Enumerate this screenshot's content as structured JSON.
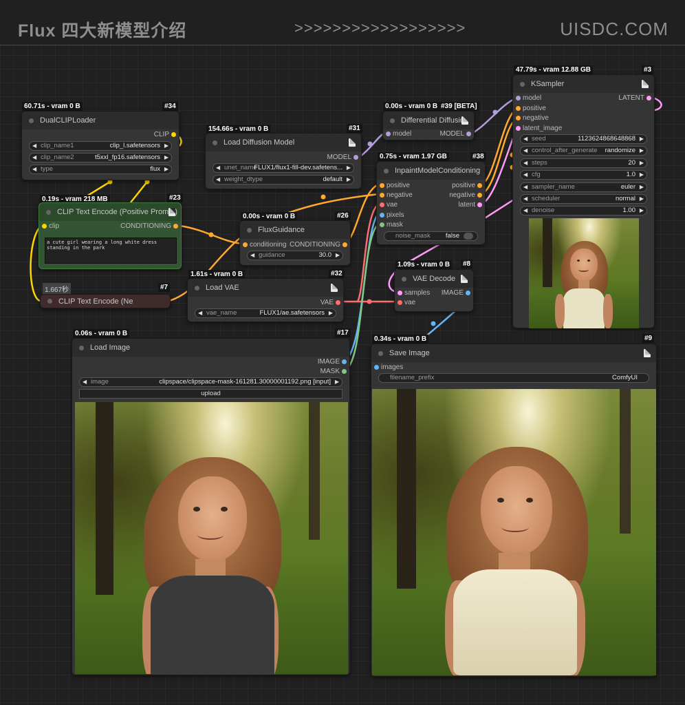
{
  "header": {
    "title": "Flux 四大新模型介绍",
    "arrows": ">>>>>>>>>>>>>>>>>>",
    "brand": "UISDC.COM"
  },
  "colors": {
    "clip": "#ffd500",
    "conditioning": "#ffa931",
    "model": "#b39ddb",
    "vae": "#ff6e6e",
    "latent": "#ff9cf9",
    "image": "#64b5f6",
    "mask": "#81c784"
  },
  "nodes": {
    "dualclip": {
      "time": "60.71s - vram 0 B",
      "id": "#34",
      "title": "DualCLIPLoader",
      "out": "CLIP",
      "widgets": [
        {
          "label": "clip_name1",
          "value": "clip_l.safetensors"
        },
        {
          "label": "clip_name2",
          "value": "t5xxl_fp16.safetensors"
        },
        {
          "label": "type",
          "value": "flux"
        }
      ]
    },
    "clippos": {
      "time": "0.19s - vram 218 MB",
      "id": "#23",
      "title": "CLIP Text Encode (Positive Prompt)",
      "in": "clip",
      "out": "CONDITIONING",
      "text": "a cute girl wearing a long white dress standing in the park"
    },
    "clipneg": {
      "badge": "1.667秒",
      "id": "#7",
      "title": "CLIP Text Encode (Ne"
    },
    "loaddiff": {
      "time": "154.66s - vram 0 B",
      "id": "#31",
      "title": "Load Diffusion Model",
      "out": "MODEL",
      "widgets": [
        {
          "label": "unet_name",
          "value": "FLUX1/flux1-fill-dev.safetens..."
        },
        {
          "label": "weight_dtype",
          "value": "default"
        }
      ]
    },
    "fluxguid": {
      "time": "0.00s - vram 0 B",
      "id": "#26",
      "title": "FluxGuidance",
      "in": "conditioning",
      "out": "CONDITIONING",
      "widgets": [
        {
          "label": "guidance",
          "value": "30.0"
        }
      ]
    },
    "loadvae": {
      "time": "1.61s - vram 0 B",
      "id": "#32",
      "title": "Load VAE",
      "out": "VAE",
      "widgets": [
        {
          "label": "vae_name",
          "value": "FLUX1/ae.safetensors"
        }
      ]
    },
    "diffdiff": {
      "time": "0.00s - vram 0 B",
      "id": "#39 [BETA]",
      "title": "Differential Diffusion",
      "in": "model",
      "out": "MODEL"
    },
    "inpaint": {
      "time": "0.75s - vram 1.97 GB",
      "id": "#38",
      "title": "InpaintModelConditioning",
      "ins": [
        "positive",
        "negative",
        "vae",
        "pixels",
        "mask"
      ],
      "outs": [
        "positive",
        "negative",
        "latent"
      ],
      "toggle": {
        "label": "noise_mask",
        "value": "false"
      }
    },
    "vaedecode": {
      "time": "1.09s - vram 0 B",
      "id": "#8",
      "title": "VAE Decode",
      "ins": [
        "samples",
        "vae"
      ],
      "out": "IMAGE"
    },
    "ksampler": {
      "time": "47.79s - vram 12.88 GB",
      "id": "#3",
      "title": "KSampler",
      "ins": [
        "model",
        "positive",
        "negative",
        "latent_image"
      ],
      "out": "LATENT",
      "widgets": [
        {
          "label": "seed",
          "value": "1123624868648868"
        },
        {
          "label": "control_after_generate",
          "value": "randomize"
        },
        {
          "label": "steps",
          "value": "20"
        },
        {
          "label": "cfg",
          "value": "1.0"
        },
        {
          "label": "sampler_name",
          "value": "euler"
        },
        {
          "label": "scheduler",
          "value": "normal"
        },
        {
          "label": "denoise",
          "value": "1.00"
        }
      ]
    },
    "loadimage": {
      "time": "0.06s - vram 0 B",
      "id": "#17",
      "title": "Load Image",
      "outs": [
        "IMAGE",
        "MASK"
      ],
      "widgets": [
        {
          "label": "image",
          "value": "clipspace/clipspace-mask-161281.30000001192.png [input]"
        }
      ],
      "button": "upload"
    },
    "saveimage": {
      "time": "0.34s - vram 0 B",
      "id": "#9",
      "title": "Save Image",
      "in": "images",
      "widgets": [
        {
          "label": "filename_prefix",
          "value": "ComfyUI"
        }
      ]
    }
  }
}
